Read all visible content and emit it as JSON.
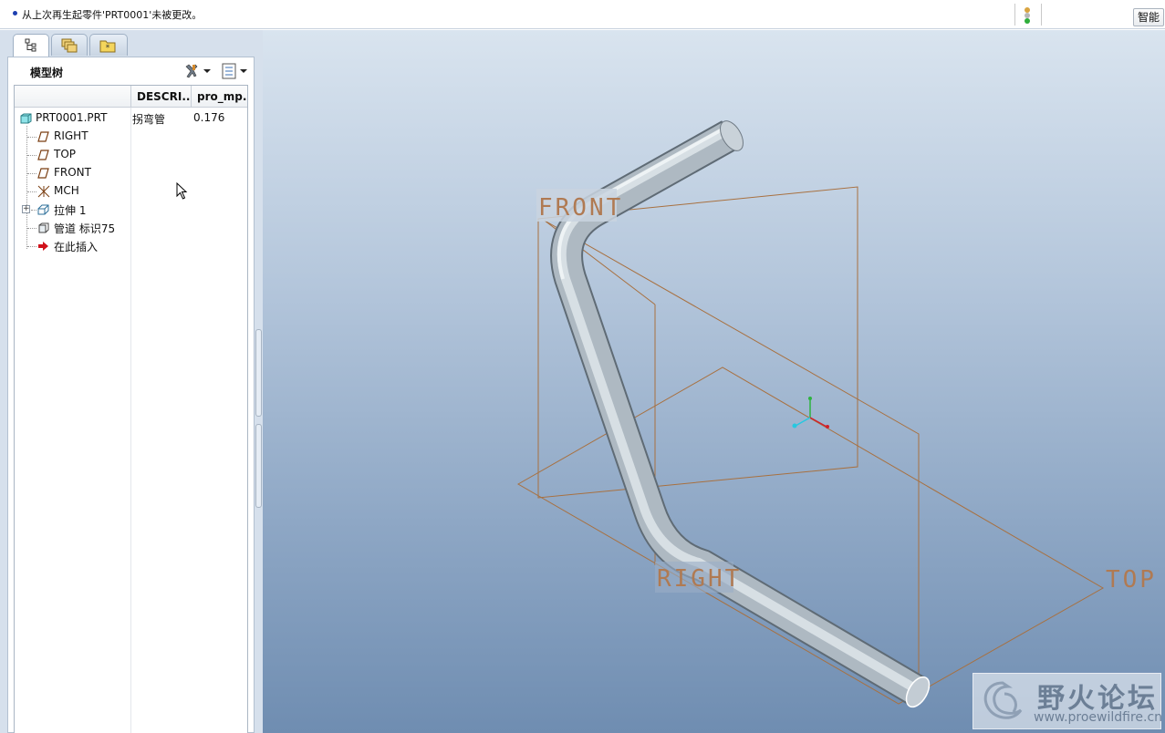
{
  "message_bar": {
    "message": "从上次再生起零件'PRT0001'未被更改。",
    "filter_label": "智能"
  },
  "left_panel": {
    "tabs": [
      {
        "name": "model-tree-tab",
        "icon": "model-tree-icon"
      },
      {
        "name": "layers-tab",
        "icon": "layers-icon"
      },
      {
        "name": "favorites-tab",
        "icon": "folder-icon"
      }
    ],
    "title": "模型树",
    "columns": [
      "DESCRI...",
      "pro_mp..."
    ],
    "rows": [
      {
        "label": "PRT0001.PRT",
        "icon": "part-icon",
        "description": "拐弯管",
        "value": "0.176"
      },
      {
        "label": "RIGHT",
        "icon": "datum-plane-icon"
      },
      {
        "label": "TOP",
        "icon": "datum-plane-icon"
      },
      {
        "label": "FRONT",
        "icon": "datum-plane-icon"
      },
      {
        "label": "MCH",
        "icon": "coordinate-system-icon"
      },
      {
        "label": "拉伸 1",
        "icon": "extrude-icon",
        "expandable": true
      },
      {
        "label": "管道 标识75",
        "icon": "pipe-icon"
      },
      {
        "label": "在此插入",
        "icon": "insert-here-arrow-icon"
      }
    ]
  },
  "viewport": {
    "datum_labels": {
      "front": "FRONT",
      "right": "RIGHT",
      "top": "TOP"
    },
    "colors": {
      "datum": "#a8703f",
      "pipe": "#b8c3cc",
      "background_top": "#d9e4ef",
      "background_bottom": "#6f8db1"
    }
  },
  "watermark": {
    "title": "野火论坛",
    "url": "www.proewildfire.cn"
  }
}
